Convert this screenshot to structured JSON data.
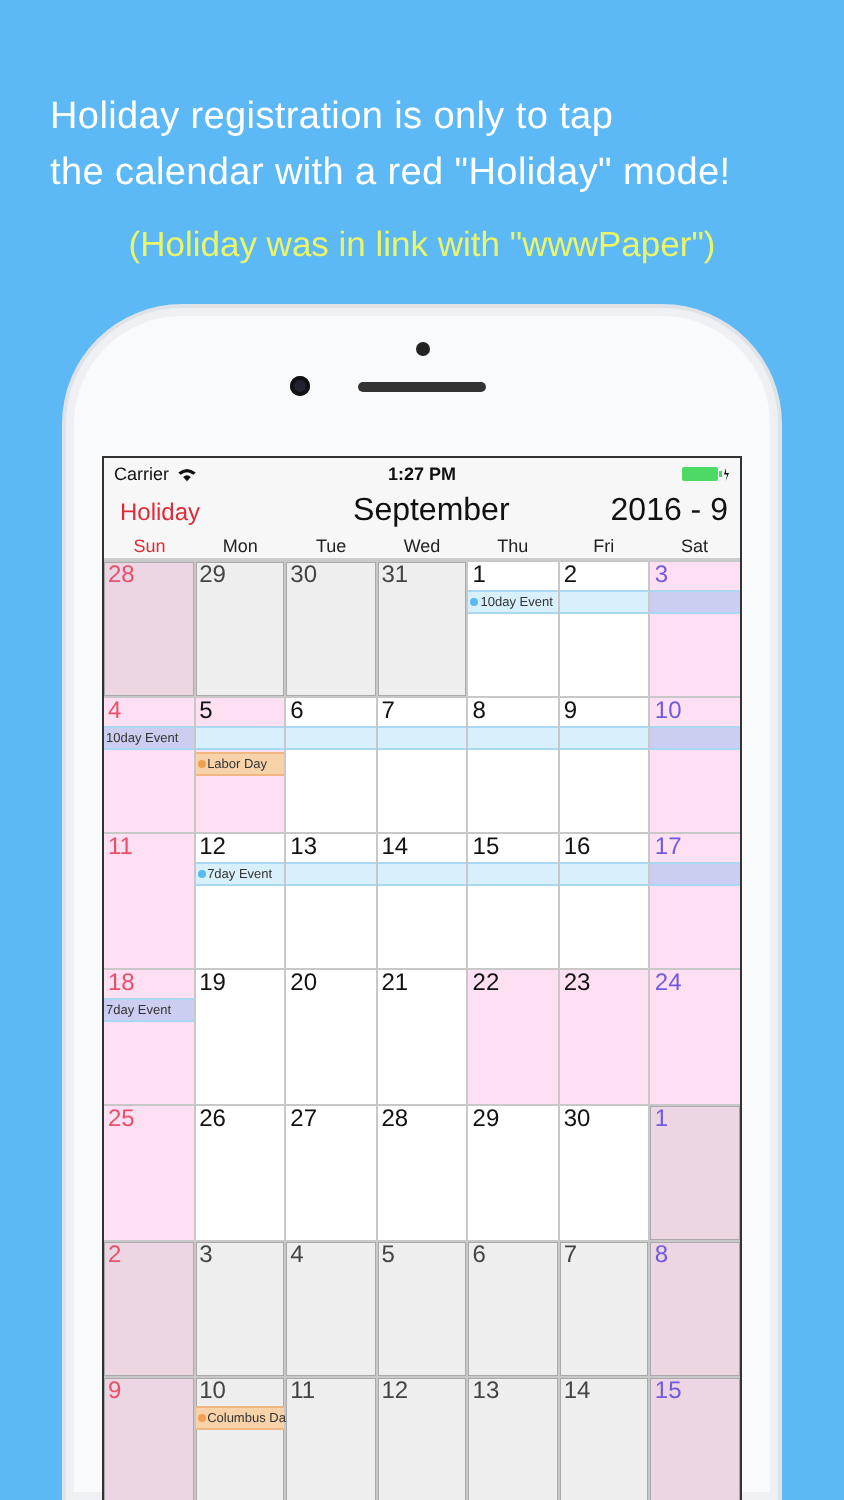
{
  "headline": [
    "Holiday registration is only to tap",
    "the calendar with a red \"Holiday\" mode!"
  ],
  "subline": "(Holiday was in link with \"wwwPaper\")",
  "status_bar": {
    "carrier": "Carrier",
    "time": "1:27 PM"
  },
  "header": {
    "mode": "Holiday",
    "month": "September",
    "year_month": "2016 - 9"
  },
  "weekdays": [
    "Sun",
    "Mon",
    "Tue",
    "Wed",
    "Thu",
    "Fri",
    "Sat"
  ],
  "weeks": [
    {
      "cells": [
        {
          "day": "28",
          "in_month": false
        },
        {
          "day": "29",
          "in_month": false,
          "holiday": false
        },
        {
          "day": "30",
          "in_month": false,
          "holiday": false
        },
        {
          "day": "31",
          "in_month": false,
          "holiday": false
        },
        {
          "day": "1",
          "in_month": true,
          "holiday": false,
          "bands": [
            {
              "kind": "span",
              "label": "10day Event",
              "dot": true
            }
          ]
        },
        {
          "day": "2",
          "in_month": true,
          "holiday": false,
          "bands": [
            {
              "kind": "span"
            }
          ]
        },
        {
          "day": "3",
          "in_month": true,
          "bands": [
            {
              "kind": "span"
            }
          ]
        }
      ]
    },
    {
      "cells": [
        {
          "day": "4",
          "in_month": true,
          "bands": [
            {
              "kind": "span",
              "label": "10day Event"
            }
          ]
        },
        {
          "day": "5",
          "in_month": true,
          "holiday": true,
          "bands": [
            {
              "kind": "span"
            },
            {
              "kind": "tag",
              "label": "Labor Day",
              "dot": true
            }
          ]
        },
        {
          "day": "6",
          "in_month": true,
          "holiday": false,
          "bands": [
            {
              "kind": "span"
            }
          ]
        },
        {
          "day": "7",
          "in_month": true,
          "holiday": false,
          "bands": [
            {
              "kind": "span"
            }
          ]
        },
        {
          "day": "8",
          "in_month": true,
          "holiday": false,
          "bands": [
            {
              "kind": "span"
            }
          ]
        },
        {
          "day": "9",
          "in_month": true,
          "holiday": false,
          "bands": [
            {
              "kind": "span"
            }
          ]
        },
        {
          "day": "10",
          "in_month": true,
          "bands": [
            {
              "kind": "span"
            }
          ]
        }
      ]
    },
    {
      "cells": [
        {
          "day": "11",
          "in_month": true
        },
        {
          "day": "12",
          "in_month": true,
          "holiday": false,
          "bands": [
            {
              "kind": "span",
              "label": "7day Event",
              "dot": true
            }
          ]
        },
        {
          "day": "13",
          "in_month": true,
          "holiday": false,
          "bands": [
            {
              "kind": "span"
            }
          ]
        },
        {
          "day": "14",
          "in_month": true,
          "holiday": false,
          "bands": [
            {
              "kind": "span"
            }
          ]
        },
        {
          "day": "15",
          "in_month": true,
          "holiday": false,
          "bands": [
            {
              "kind": "span"
            }
          ]
        },
        {
          "day": "16",
          "in_month": true,
          "holiday": false,
          "bands": [
            {
              "kind": "span"
            }
          ]
        },
        {
          "day": "17",
          "in_month": true,
          "bands": [
            {
              "kind": "span"
            }
          ]
        }
      ]
    },
    {
      "cells": [
        {
          "day": "18",
          "in_month": true,
          "bands": [
            {
              "kind": "span",
              "label": "7day Event"
            }
          ]
        },
        {
          "day": "19",
          "in_month": true,
          "holiday": false
        },
        {
          "day": "20",
          "in_month": true,
          "holiday": false
        },
        {
          "day": "21",
          "in_month": true,
          "holiday": false
        },
        {
          "day": "22",
          "in_month": true,
          "holiday": true
        },
        {
          "day": "23",
          "in_month": true,
          "holiday": true
        },
        {
          "day": "24",
          "in_month": true
        }
      ]
    },
    {
      "cells": [
        {
          "day": "25",
          "in_month": true
        },
        {
          "day": "26",
          "in_month": true,
          "holiday": false
        },
        {
          "day": "27",
          "in_month": true,
          "holiday": false
        },
        {
          "day": "28",
          "in_month": true,
          "holiday": false
        },
        {
          "day": "29",
          "in_month": true,
          "holiday": false
        },
        {
          "day": "30",
          "in_month": true,
          "holiday": false
        },
        {
          "day": "1",
          "in_month": false
        }
      ]
    },
    {
      "cells": [
        {
          "day": "2",
          "in_month": false
        },
        {
          "day": "3",
          "in_month": false,
          "holiday": false
        },
        {
          "day": "4",
          "in_month": false,
          "holiday": false
        },
        {
          "day": "5",
          "in_month": false,
          "holiday": false
        },
        {
          "day": "6",
          "in_month": false,
          "holiday": false
        },
        {
          "day": "7",
          "in_month": false,
          "holiday": false
        },
        {
          "day": "8",
          "in_month": false
        }
      ]
    },
    {
      "cells": [
        {
          "day": "9",
          "in_month": false
        },
        {
          "day": "10",
          "in_month": false,
          "holiday": false,
          "bands": [
            {
              "kind": "tag",
              "label": "Columbus Da",
              "dot": true
            }
          ]
        },
        {
          "day": "11",
          "in_month": false,
          "holiday": false
        },
        {
          "day": "12",
          "in_month": false,
          "holiday": false
        },
        {
          "day": "13",
          "in_month": false,
          "holiday": false
        },
        {
          "day": "14",
          "in_month": false,
          "holiday": false
        },
        {
          "day": "15",
          "in_month": false
        }
      ]
    }
  ]
}
